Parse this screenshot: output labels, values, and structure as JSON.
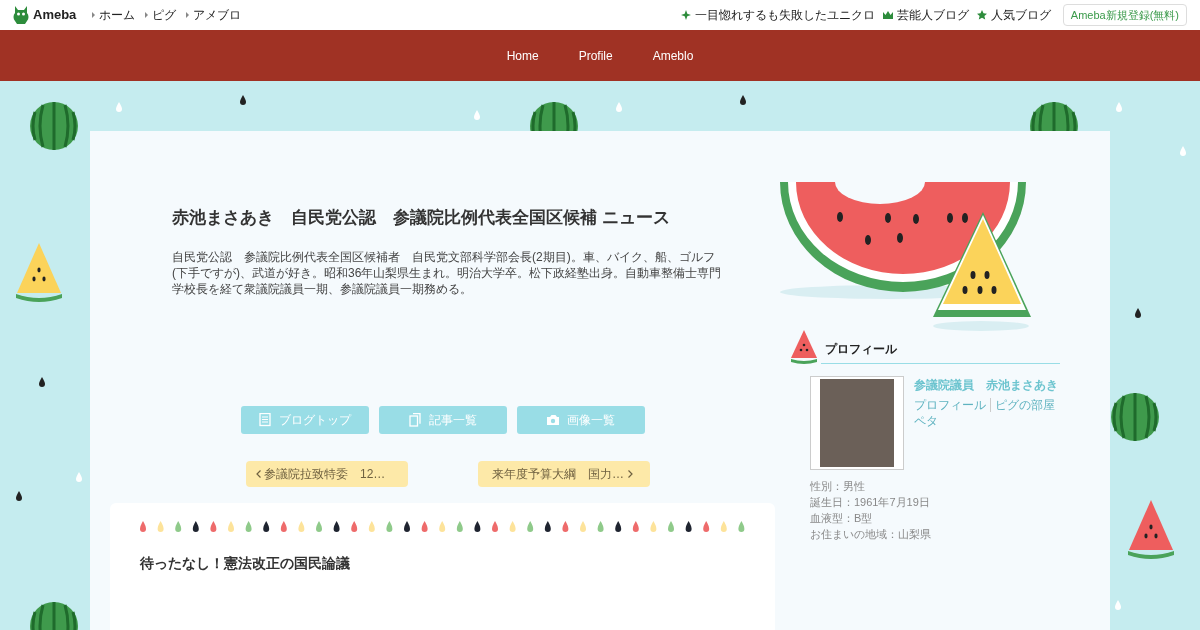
{
  "top_bar": {
    "logo": "Ameba",
    "links": [
      "ホーム",
      "ピグ",
      "アメブロ"
    ],
    "right_links": [
      {
        "kind": "sparkle",
        "label": "一目惚れするも失敗したユニクロ"
      },
      {
        "kind": "crown",
        "label": "芸能人ブログ"
      },
      {
        "kind": "star",
        "label": "人気ブログ"
      }
    ],
    "register_button": "Ameba新規登録(無料)"
  },
  "nav": [
    "Home",
    "Profile",
    "Ameblo"
  ],
  "blog": {
    "title": "赤池まさあき　自民党公認　参議院比例代表全国区候補 ニュース",
    "description": "自民党公認　参議院比例代表全国区候補者　自民党文部科学部会長(2期目)。車、バイク、船、ゴルフ(下手ですが)、武道が好き。昭和36年山梨県生まれ。明治大学卒。松下政経塾出身。自動車整備士専門学校長を経て衆議院議員一期、参議院議員一期務める。"
  },
  "blog_buttons": [
    {
      "kind": "list",
      "label": "ブログトップ"
    },
    {
      "kind": "copy",
      "label": "記事一覧"
    },
    {
      "kind": "camera",
      "label": "画像一覧"
    }
  ],
  "pager": {
    "previous": "参議院拉致特委　12…",
    "next": "来年度予算大綱　国力…"
  },
  "article": {
    "title": "待ったなし！憲法改正の国民論議"
  },
  "profile": {
    "heading": "プロフィール",
    "name": "参議院議員　赤池まさあき",
    "links": [
      "プロフィール",
      "ピグの部屋"
    ],
    "extra_link": "ペタ",
    "details": [
      "性別：男性",
      "誕生日：1961年7月19日",
      "血液型：B型",
      "お住まいの地域：山梨県"
    ]
  }
}
